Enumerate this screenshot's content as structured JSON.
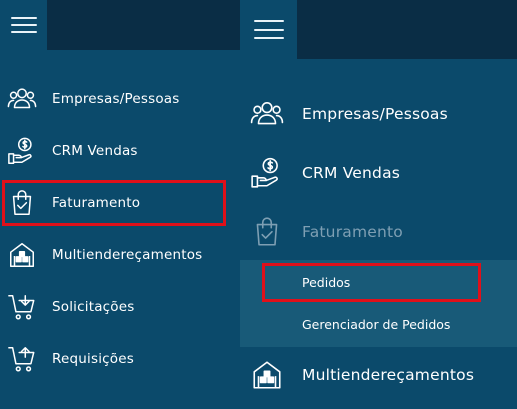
{
  "left_menu": {
    "items": [
      {
        "label": "Empresas/Pessoas",
        "icon": "people-icon"
      },
      {
        "label": "CRM Vendas",
        "icon": "money-hand-icon"
      },
      {
        "label": "Faturamento",
        "icon": "shopping-bag-check-icon"
      },
      {
        "label": "Multiendereçamentos",
        "icon": "warehouse-icon"
      },
      {
        "label": "Solicitações",
        "icon": "cart-download-icon"
      },
      {
        "label": "Requisições",
        "icon": "cart-upload-icon"
      }
    ]
  },
  "right_menu": {
    "items": [
      {
        "label": "Empresas/Pessoas",
        "icon": "people-icon"
      },
      {
        "label": "CRM Vendas",
        "icon": "money-hand-icon"
      },
      {
        "label": "Faturamento",
        "icon": "shopping-bag-check-icon"
      },
      {
        "label": "Multiendereçamentos",
        "icon": "warehouse-icon"
      }
    ],
    "submenu": [
      {
        "label": "Pedidos"
      },
      {
        "label": "Gerenciador de Pedidos"
      }
    ]
  },
  "colors": {
    "sidebar_bg": "#0b4a6b",
    "topbar_dark": "#0a2d45",
    "submenu_bg": "#185a78",
    "highlight": "#e0101a",
    "dim_text": "#7e9fb3"
  }
}
